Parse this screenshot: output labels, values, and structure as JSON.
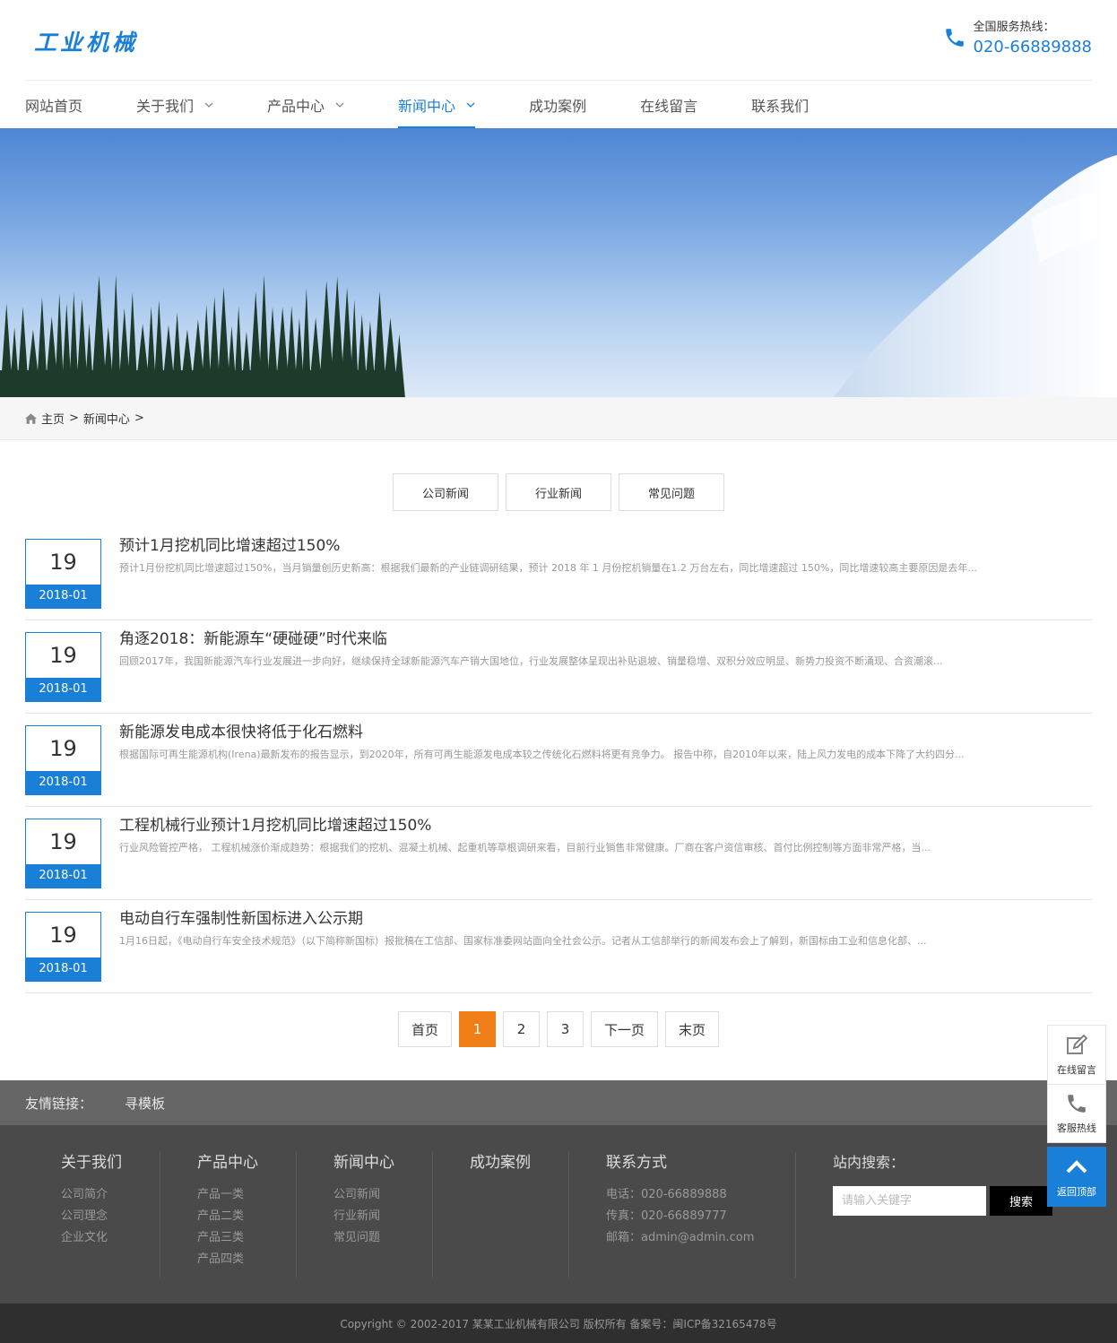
{
  "header": {
    "logo": "工业机械",
    "hotline_label": "全国服务热线：",
    "hotline_number": "020-66889888"
  },
  "nav": {
    "items": [
      {
        "label": "网站首页",
        "dropdown": false
      },
      {
        "label": "关于我们",
        "dropdown": true
      },
      {
        "label": "产品中心",
        "dropdown": true
      },
      {
        "label": "新闻中心",
        "dropdown": true,
        "active": true
      },
      {
        "label": "成功案例",
        "dropdown": false
      },
      {
        "label": "在线留言",
        "dropdown": false
      },
      {
        "label": "联系我们",
        "dropdown": false
      }
    ]
  },
  "breadcrumb": {
    "home": "主页",
    "sep": ">",
    "current": "新闻中心"
  },
  "tabs": [
    "公司新闻",
    "行业新闻",
    "常见问题"
  ],
  "news": [
    {
      "day": "19",
      "ym": "2018-01",
      "title": "预计1月挖机同比增速超过150%",
      "desc": "预计1月份挖机同比增速超过150%，当月销量创历史新高：根据我们最新的产业链调研结果，预计 2018 年 1 月份挖机销量在1.2 万台左右，同比增速超过 150%，同比增速较高主要原因是去年..."
    },
    {
      "day": "19",
      "ym": "2018-01",
      "title": "角逐2018：新能源车“硬碰硬”时代来临",
      "desc": "回顾2017年，我国新能源汽车行业发展进一步向好，继续保持全球新能源汽车产销大国地位，行业发展整体呈现出补贴退坡、销量稳增、双积分效应明显、新势力投资不断涌现、合资潮滚..."
    },
    {
      "day": "19",
      "ym": "2018-01",
      "title": "新能源发电成本很快将低于化石燃料",
      "desc": "根据国际可再生能源机构(Irena)最新发布的报告显示，到2020年，所有可再生能源发电成本较之传统化石燃料将更有竞争力。 报告中称，自2010年以来，陆上风力发电的成本下降了大约四分..."
    },
    {
      "day": "19",
      "ym": "2018-01",
      "title": "工程机械行业预计1月挖机同比增速超过150%",
      "desc": "行业风险管控严格， 工程机械涨价渐成趋势：根据我们的挖机、混凝土机械、起重机等草根调研来看，目前行业销售非常健康。厂商在客户资信审核、首付比例控制等方面非常严格，当..."
    },
    {
      "day": "19",
      "ym": "2018-01",
      "title": "电动自行车强制性新国标进入公示期",
      "desc": "1月16日起，《电动自行车安全技术规范》（以下简称新国标）报批稿在工信部、国家标准委网站面向全社会公示。记者从工信部举行的新闻发布会上了解到，新国标由工业和信息化部、..."
    }
  ],
  "pager": {
    "first": "首页",
    "pages": [
      "1",
      "2",
      "3"
    ],
    "current": "1",
    "next": "下一页",
    "last": "末页"
  },
  "friend": {
    "label": "友情链接：",
    "links": [
      "寻模板"
    ]
  },
  "footer": {
    "cols": [
      {
        "title": "关于我们",
        "links": [
          "公司简介",
          "公司理念",
          "企业文化"
        ]
      },
      {
        "title": "产品中心",
        "links": [
          "产品一类",
          "产品二类",
          "产品三类",
          "产品四类"
        ]
      },
      {
        "title": "新闻中心",
        "links": [
          "公司新闻",
          "行业新闻",
          "常见问题"
        ]
      },
      {
        "title": "成功案例",
        "links": []
      },
      {
        "title": "联系方式",
        "links": [
          "电话：020-66889888",
          "传真：020-66889777",
          "邮箱：admin@admin.com"
        ]
      }
    ],
    "search_title": "站内搜索：",
    "search_placeholder": "请输入关键字",
    "search_button": "搜索",
    "copyright": "Copyright © 2002-2017 某某工业机械有限公司 版权所有    备案号：闽ICP备32165478号"
  },
  "side": {
    "message": "在线留言",
    "hotline": "客服热线",
    "top": "返回顶部"
  },
  "colors": {
    "accent": "#1a7fd6",
    "pager_current": "#f07e16"
  }
}
